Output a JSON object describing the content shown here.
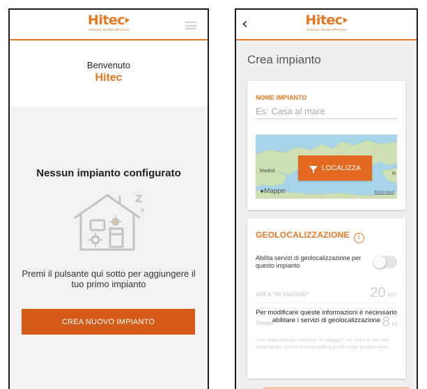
{
  "logo": {
    "text": "Hitec",
    "tagline": "soluzioni ad alta efficienza"
  },
  "icons": {
    "menu": "hamburger-icon",
    "back": "chevron-left-icon",
    "info": "info-circle-icon",
    "filter": "filter-icon",
    "house": "house-sleeping-icon"
  },
  "colors": {
    "accent": "#e8761e",
    "button": "#d35a17",
    "background": "#f2f2f2"
  },
  "screen1": {
    "welcome_line": "Benvenuto",
    "welcome_name": "Hitec",
    "empty_title": "Nessun impianto configurato",
    "hint": "Premi il pulsante qui sotto per aggiungere il tuo primo impianto",
    "create_button": "CREA NUOVO IMPIANTO"
  },
  "screen2": {
    "back_glyph": "‹",
    "title": "Crea impianto",
    "name_label": "NOME IMPIANTO",
    "name_placeholder": "Es: Casa al mare",
    "map": {
      "city_left": "Madrid",
      "city_right": "R",
      "brand": "Mappe",
      "legal": "Avvisi legali",
      "locate_button": "LOCALIZZA"
    },
    "geo": {
      "title": "GEOLOCALIZZAZIONE",
      "info_glyph": "i",
      "toggle_label": "Abilita servizi di geolocalizzazione per questo impianto",
      "toggle_on": false,
      "area_label": "AREA \"IN VIAGGIO\"",
      "area_value": "20",
      "area_unit": "km",
      "time_label": "Tempo",
      "time_value": "8",
      "time_unit": "H",
      "time_desc": "Una volta entrato nell'area \"in viaggio\", se entro 8 ore non sarai uscito riceverai una notifica push come promemoria",
      "overlay": "Per modificare queste informazioni è necessario abilitare i servizi di geolocalizzazione"
    }
  }
}
